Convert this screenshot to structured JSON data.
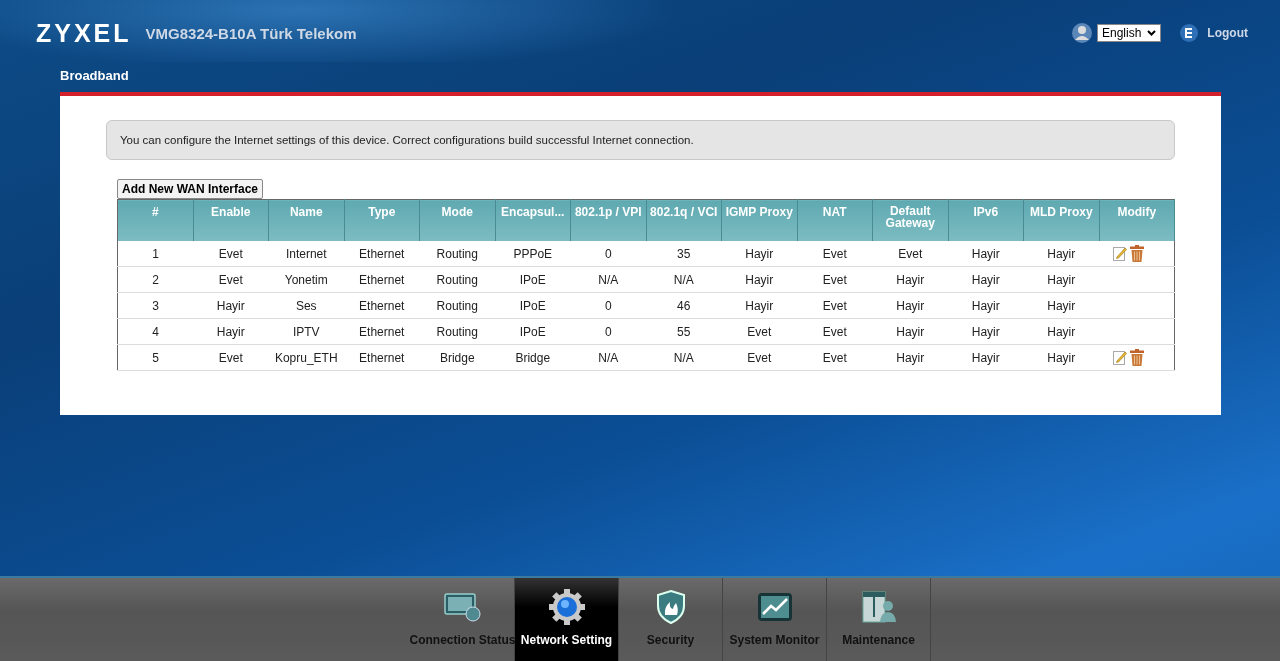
{
  "header": {
    "logo": "ZYXEL",
    "model": "VMG8324-B10A Türk Telekom",
    "language": "English",
    "logout": "Logout"
  },
  "page_title": "Broadband",
  "info": "You can configure the Internet settings of this device. Correct configurations build successful Internet connection.",
  "add_button": "Add New WAN Interface",
  "table": {
    "columns": [
      "#",
      "Enable",
      "Name",
      "Type",
      "Mode",
      "Encapsul...",
      "802.1p / VPI",
      "802.1q / VCI",
      "IGMP Proxy",
      "NAT",
      "Default Gateway",
      "IPv6",
      "MLD Proxy",
      "Modify"
    ],
    "rows": [
      {
        "cells": [
          "1",
          "Evet",
          "Internet",
          "Ethernet",
          "Routing",
          "PPPoE",
          "0",
          "35",
          "Hayir",
          "Evet",
          "Evet",
          "Hayir",
          "Hayir"
        ],
        "editable": true
      },
      {
        "cells": [
          "2",
          "Evet",
          "Yonetim",
          "Ethernet",
          "Routing",
          "IPoE",
          "N/A",
          "N/A",
          "Hayir",
          "Evet",
          "Hayir",
          "Hayir",
          "Hayir"
        ],
        "editable": false
      },
      {
        "cells": [
          "3",
          "Hayir",
          "Ses",
          "Ethernet",
          "Routing",
          "IPoE",
          "0",
          "46",
          "Hayir",
          "Evet",
          "Hayir",
          "Hayir",
          "Hayir"
        ],
        "editable": false
      },
      {
        "cells": [
          "4",
          "Hayir",
          "IPTV",
          "Ethernet",
          "Routing",
          "IPoE",
          "0",
          "55",
          "Evet",
          "Evet",
          "Hayir",
          "Hayir",
          "Hayir"
        ],
        "editable": false
      },
      {
        "cells": [
          "5",
          "Evet",
          "Kopru_ETH",
          "Ethernet",
          "Bridge",
          "Bridge",
          "N/A",
          "N/A",
          "Evet",
          "Evet",
          "Hayir",
          "Hayir",
          "Hayir"
        ],
        "editable": true
      }
    ]
  },
  "nav": [
    {
      "label": "Connection Status",
      "kind": "status",
      "selected": false
    },
    {
      "label": "Network Setting",
      "kind": "network",
      "selected": true
    },
    {
      "label": "Security",
      "kind": "security",
      "selected": false
    },
    {
      "label": "System Monitor",
      "kind": "monitor",
      "selected": false
    },
    {
      "label": "Maintenance",
      "kind": "maintenance",
      "selected": false
    }
  ]
}
